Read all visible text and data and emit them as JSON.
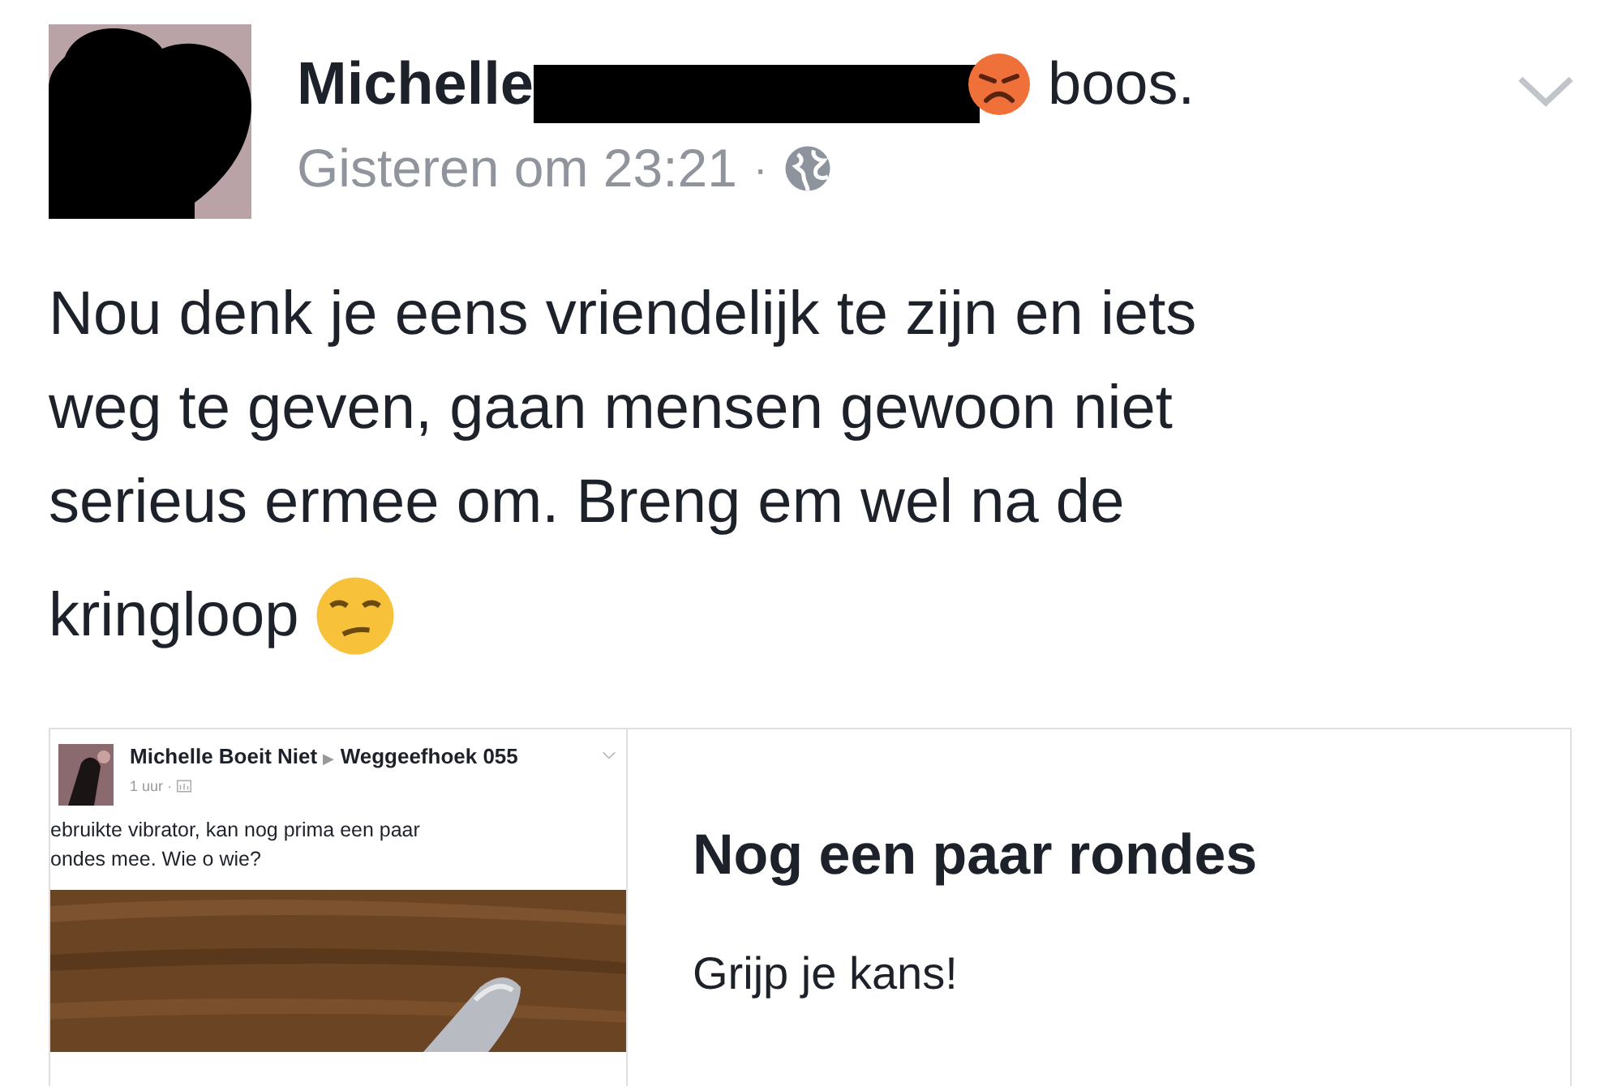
{
  "post": {
    "author": "Michelle",
    "feeling": "boos.",
    "time": "Gisteren om 23:21",
    "separator": "·",
    "text_lines": [
      "Nou denk je eens vriendelijk te zijn en iets",
      "weg te geven, gaan mensen gewoon niet",
      "serieus ermee om. Breng em wel na de",
      "kringloop"
    ]
  },
  "shared_card": {
    "screenshot": {
      "author": "Michelle Boeit Niet",
      "arrow": "▶",
      "group": "Weggeefhoek 055",
      "time": "1 uur ·",
      "text_lines": [
        "ebruikte vibrator, kan nog prima een paar",
        "ondes mee. Wie o wie?"
      ]
    },
    "title": "Nog een paar rondes",
    "subtitle": "Grijp je kans!"
  }
}
